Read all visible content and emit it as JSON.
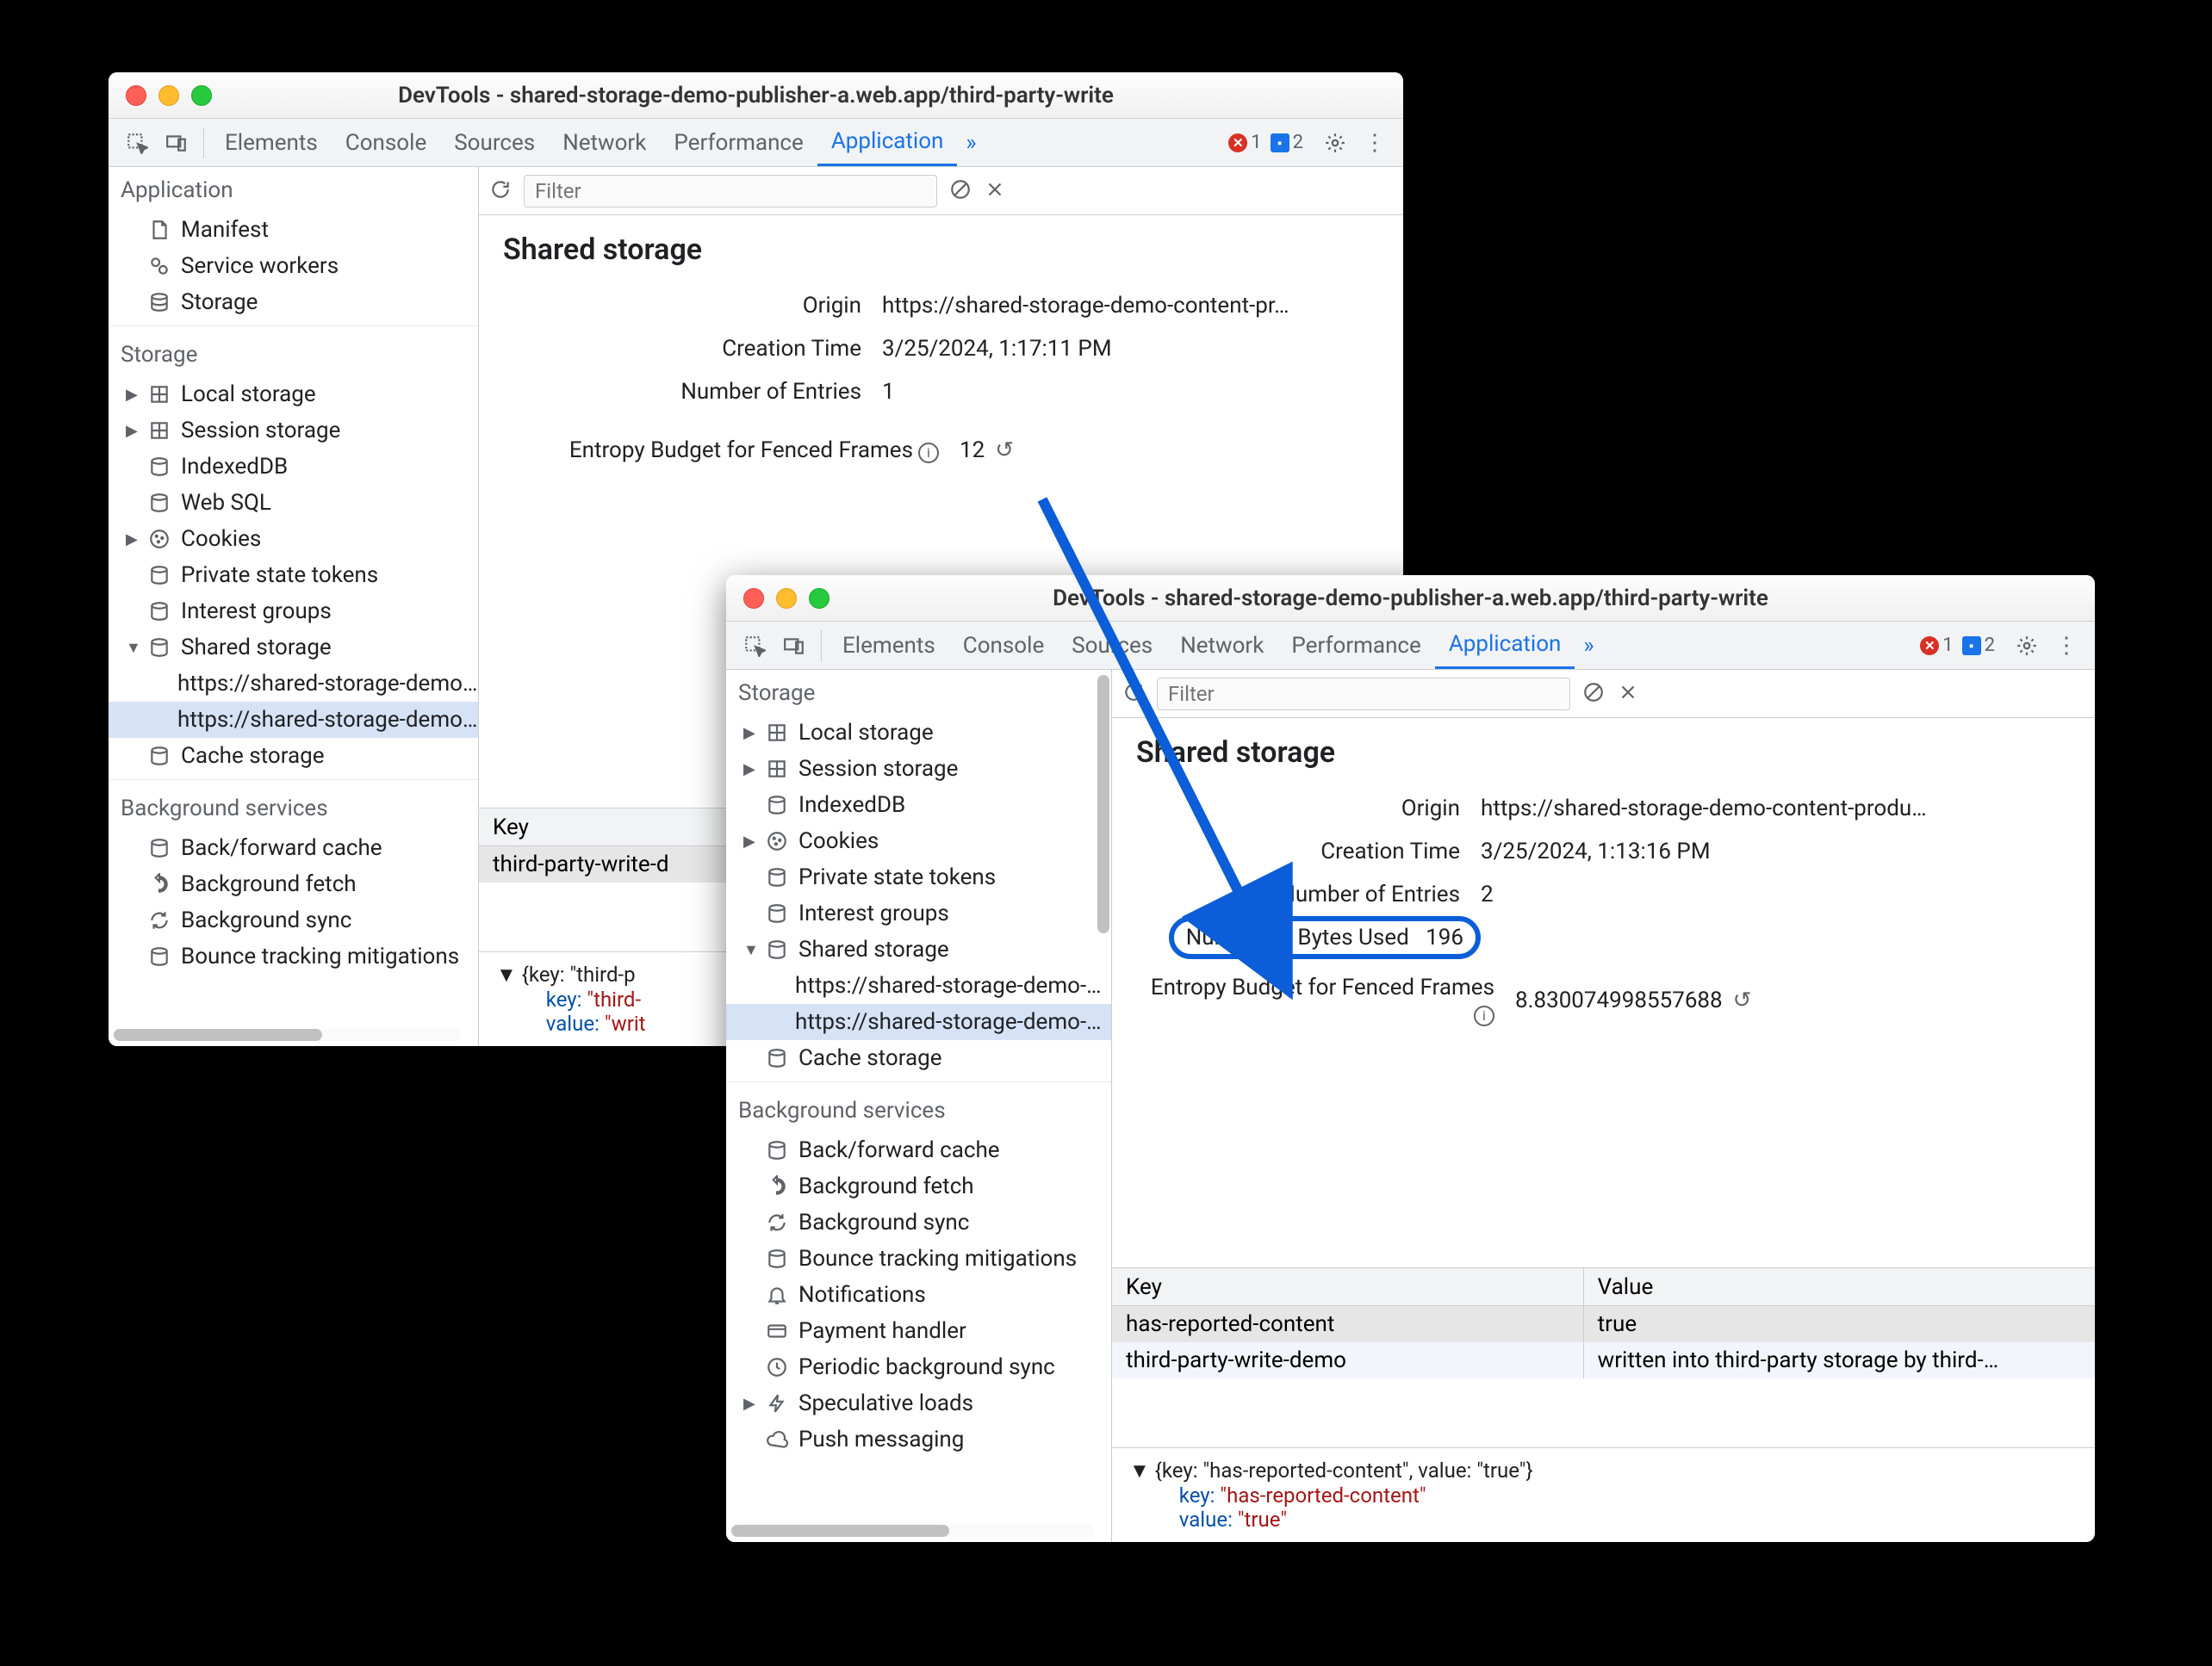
{
  "window1": {
    "title": "DevTools - shared-storage-demo-publisher-a.web.app/third-party-write",
    "tabs": [
      "Elements",
      "Console",
      "Sources",
      "Network",
      "Performance",
      "Application"
    ],
    "error_count": "1",
    "issue_count": "2",
    "filter_placeholder": "Filter",
    "sidebar": {
      "application": {
        "title": "Application",
        "items": [
          "Manifest",
          "Service workers",
          "Storage"
        ]
      },
      "storage": {
        "title": "Storage",
        "local": "Local storage",
        "session": "Session storage",
        "idb": "IndexedDB",
        "websql": "Web SQL",
        "cookies": "Cookies",
        "pst": "Private state tokens",
        "ig": "Interest groups",
        "shared": "Shared storage",
        "shared_items": [
          "https://shared-storage-demo-…",
          "https://shared-storage-demo-…"
        ],
        "cache": "Cache storage"
      },
      "bg": {
        "title": "Background services",
        "bfc": "Back/forward cache",
        "bfetch": "Background fetch",
        "bsync": "Background sync",
        "bounce": "Bounce tracking mitigations"
      }
    },
    "detail": {
      "heading": "Shared storage",
      "origin_label": "Origin",
      "origin_value": "https://shared-storage-demo-content-pr…",
      "ctime_label": "Creation Time",
      "ctime_value": "3/25/2024, 1:17:11 PM",
      "entries_label": "Number of Entries",
      "entries_value": "1",
      "entropy_label": "Entropy Budget for Fenced Frames",
      "entropy_value": "12"
    },
    "table": {
      "key_hdr": "Key",
      "rows": [
        {
          "key": "third-party-write-d"
        }
      ]
    },
    "json": {
      "line1": "▼ {key: \"third-p",
      "key_label": "key: ",
      "key_val": "\"third-",
      "val_label": "value: ",
      "val_val": "\"writ"
    }
  },
  "window2": {
    "title": "DevTools - shared-storage-demo-publisher-a.web.app/third-party-write",
    "tabs": [
      "Elements",
      "Console",
      "Sources",
      "Network",
      "Performance",
      "Application"
    ],
    "error_count": "1",
    "issue_count": "2",
    "filter_placeholder": "Filter",
    "sidebar": {
      "storage": {
        "title": "Storage",
        "local": "Local storage",
        "session": "Session storage",
        "idb": "IndexedDB",
        "cookies": "Cookies",
        "pst": "Private state tokens",
        "ig": "Interest groups",
        "shared": "Shared storage",
        "shared_items": [
          "https://shared-storage-demo-…",
          "https://shared-storage-demo-…"
        ],
        "cache": "Cache storage"
      },
      "bg": {
        "title": "Background services",
        "bfc": "Back/forward cache",
        "bfetch": "Background fetch",
        "bsync": "Background sync",
        "bounce": "Bounce tracking mitigations",
        "notif": "Notifications",
        "payment": "Payment handler",
        "periodic": "Periodic background sync",
        "spec": "Speculative loads",
        "push": "Push messaging"
      }
    },
    "detail": {
      "heading": "Shared storage",
      "origin_label": "Origin",
      "origin_value": "https://shared-storage-demo-content-produ…",
      "ctime_label": "Creation Time",
      "ctime_value": "3/25/2024, 1:13:16 PM",
      "entries_label": "Number of Entries",
      "entries_value": "2",
      "bytes_label": "Number of Bytes Used",
      "bytes_value": "196",
      "entropy_label": "Entropy Budget for Fenced Frames",
      "entropy_value": "8.830074998557688"
    },
    "table": {
      "key_hdr": "Key",
      "val_hdr": "Value",
      "rows": [
        {
          "key": "has-reported-content",
          "val": "true"
        },
        {
          "key": "third-party-write-demo",
          "val": "written into third-party storage by third-…"
        }
      ]
    },
    "json": {
      "line1": "▼ {key: \"has-reported-content\", value: \"true\"}",
      "key_label": "key: ",
      "key_val": "\"has-reported-content\"",
      "val_label": "value: ",
      "val_val": "\"true\""
    }
  }
}
